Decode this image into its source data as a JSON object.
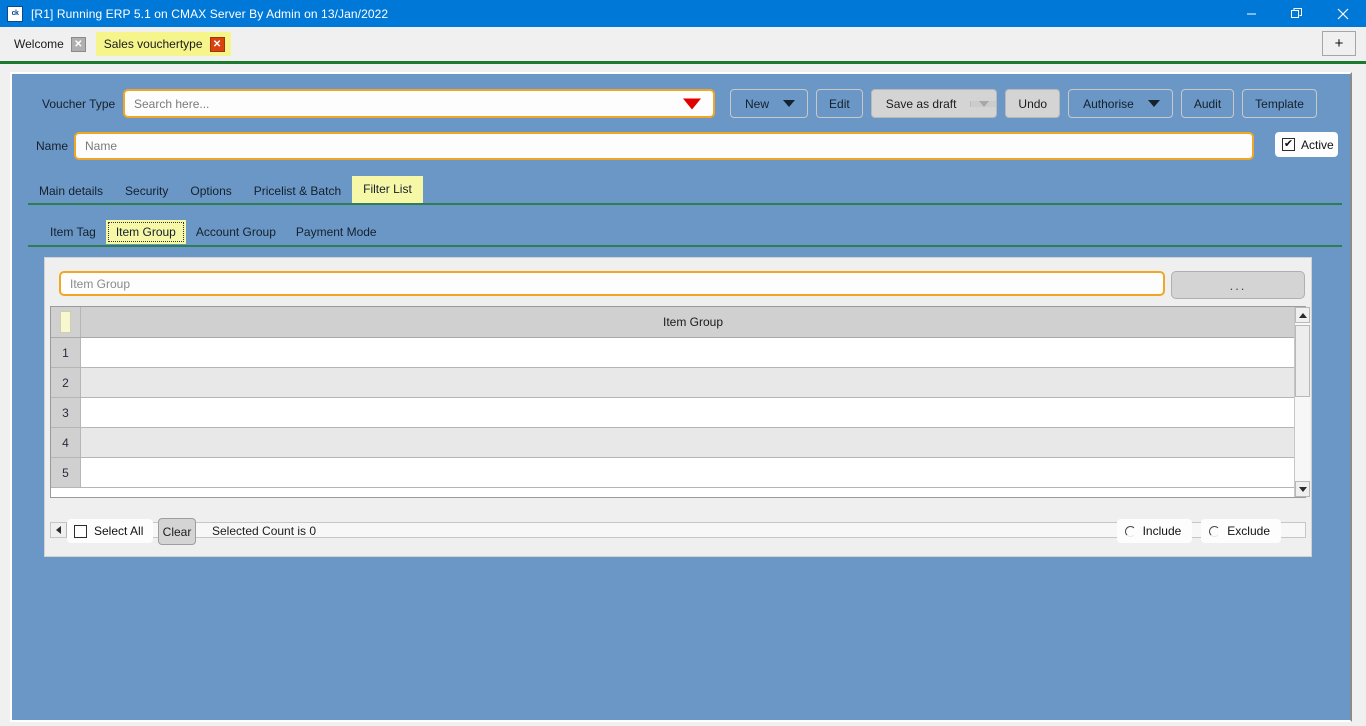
{
  "titlebar": {
    "logo": "ck",
    "title": "[R1] Running ERP 5.1 on CMAX Server By Admin on 13/Jan/2022",
    "minimize_icon": "minimize-icon",
    "restore_icon": "restore-icon",
    "close_icon": "close-icon"
  },
  "tabstrip": {
    "tabs": [
      {
        "label": "Welcome",
        "active": false,
        "close": "✕"
      },
      {
        "label": "Sales vouchertype",
        "active": true,
        "close": "✕"
      }
    ],
    "add_tab_label": "+"
  },
  "form": {
    "voucher_type_label": "Voucher Type",
    "voucher_type_placeholder": "Search here...",
    "name_label": "Name",
    "name_placeholder": "Name",
    "active_label": "Active",
    "active_checked": true,
    "active_check_glyph": "✔"
  },
  "toolbar": {
    "new_label": "New",
    "edit_label": "Edit",
    "save_as_draft_label": "Save as draft",
    "undo_label": "Undo",
    "authorise_label": "Authorise",
    "audit_label": "Audit",
    "template_label": "Template"
  },
  "main_tabs": [
    {
      "label": "Main details",
      "active": false
    },
    {
      "label": "Security",
      "active": false
    },
    {
      "label": "Options",
      "active": false
    },
    {
      "label": "Pricelist & Batch",
      "active": false
    },
    {
      "label": "Filter List",
      "active": true
    }
  ],
  "sub_tabs": [
    {
      "label": "Item Tag",
      "active": false
    },
    {
      "label": "Item Group",
      "active": true
    },
    {
      "label": "Account Group",
      "active": false
    },
    {
      "label": "Payment Mode",
      "active": false
    }
  ],
  "filter_panel": {
    "search_placeholder": "Item Group",
    "browse_button_label": "...",
    "grid": {
      "column_header": "Item Group",
      "rows": [
        {
          "num": "1",
          "value": ""
        },
        {
          "num": "2",
          "value": ""
        },
        {
          "num": "3",
          "value": ""
        },
        {
          "num": "4",
          "value": ""
        },
        {
          "num": "5",
          "value": ""
        }
      ]
    },
    "select_all_label": "Select All",
    "select_all_checked": false,
    "clear_button_label": "Clear",
    "selected_count_text": "Selected Count is 0",
    "include_label": "Include",
    "exclude_label": "Exclude",
    "include_selected": false,
    "exclude_selected": false
  },
  "colors": {
    "titlebar": "#0078d7",
    "panel_blue": "#6a97c6",
    "accent_orange": "#f0a726",
    "tab_yellow": "#f5f58c",
    "green_rule": "#2f7d53",
    "close_red": "#d9430f"
  }
}
